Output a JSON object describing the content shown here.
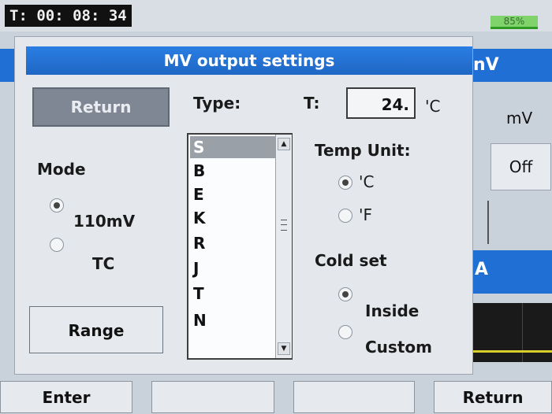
{
  "status": {
    "timer": "T: 00: 08: 34",
    "battery": "85%"
  },
  "background": {
    "title": "nV",
    "unit": "mV",
    "off_button": "Off",
    "panel_label": "A"
  },
  "dialog": {
    "title": "MV output settings",
    "return_button": "Return",
    "type_label": "Type:",
    "t_label": "T:",
    "t_value": "24.",
    "t_unit": "'C",
    "mode": {
      "label": "Mode",
      "options": [
        {
          "label": "110mV",
          "selected": true
        },
        {
          "label": "TC",
          "selected": false
        }
      ]
    },
    "type_list": {
      "items": [
        "S",
        "B",
        "E",
        "K",
        "R",
        "J",
        "T",
        "N"
      ],
      "selected": "S"
    },
    "temp_unit": {
      "label": "Temp Unit:",
      "options": [
        {
          "label": "'C",
          "selected": true
        },
        {
          "label": "'F",
          "selected": false
        }
      ]
    },
    "cold_set": {
      "label": "Cold set",
      "options": [
        {
          "label": "Inside",
          "selected": true
        },
        {
          "label": "Custom",
          "selected": false
        }
      ]
    },
    "range_button": "Range"
  },
  "softkeys": [
    "Enter",
    "",
    "",
    "Return"
  ],
  "colors": {
    "accent": "#1f6fd4",
    "battery": "#7fd36a"
  }
}
